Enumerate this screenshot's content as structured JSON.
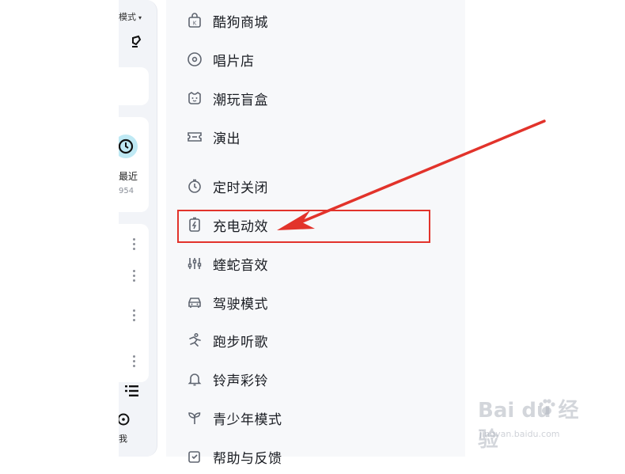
{
  "left_panel": {
    "mode_label": "模式",
    "mode_caret": "▾",
    "recent_label": "最近",
    "recent_count": "954",
    "me_label": "我"
  },
  "menu": {
    "items": [
      {
        "label": "酷狗商城",
        "icon": "shop-bag-icon"
      },
      {
        "label": "唱片店",
        "icon": "vinyl-disc-icon"
      },
      {
        "label": "潮玩盲盒",
        "icon": "toy-face-icon"
      },
      {
        "label": "演出",
        "icon": "ticket-icon"
      },
      {
        "label": "定时关闭",
        "icon": "timer-icon"
      },
      {
        "label": "充电动效",
        "icon": "charging-bolt-icon"
      },
      {
        "label": "蝰蛇音效",
        "icon": "equalizer-icon"
      },
      {
        "label": "驾驶模式",
        "icon": "car-icon"
      },
      {
        "label": "跑步听歌",
        "icon": "running-icon"
      },
      {
        "label": "铃声彩铃",
        "icon": "bell-icon"
      },
      {
        "label": "青少年模式",
        "icon": "sprout-icon"
      },
      {
        "label": "帮助与反馈",
        "icon": "help-feedback-icon"
      }
    ]
  },
  "annotation": {
    "highlight_color": "#e2332b"
  },
  "watermark": {
    "brand": "Bai du 经验",
    "url": "jingyan.baidu.com"
  }
}
